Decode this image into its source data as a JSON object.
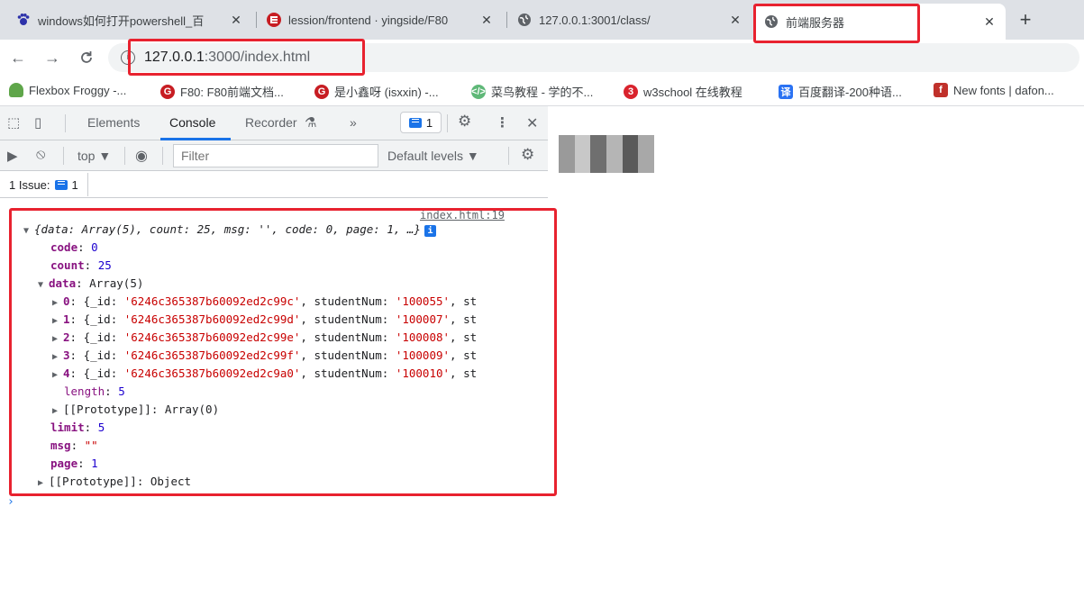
{
  "browser": {
    "tabs": [
      {
        "title": "windows如何打开powershell_百",
        "icon": "paw-icon"
      },
      {
        "title": "lession/frontend · yingside/F80",
        "icon": "gitee-icon"
      },
      {
        "title": "127.0.0.1:3001/class/",
        "icon": "globe-icon"
      },
      {
        "title": "前端服务器",
        "icon": "globe-icon",
        "active": true
      }
    ],
    "new_tab": "+",
    "close_glyph": "✕",
    "url_host": "127.0.0.1",
    "url_rest": ":3000/index.html"
  },
  "bookmarks": [
    {
      "label": "Flexbox Froggy -...",
      "icon": "frog-icon",
      "color": "#5fa64a"
    },
    {
      "label": "F80: F80前端文档...",
      "icon": "gitee-icon",
      "color": "#c71d23"
    },
    {
      "label": "是小鑫呀 (isxxin) -...",
      "icon": "gitee-icon",
      "color": "#c71d23"
    },
    {
      "label": "菜鸟教程 - 学的不...",
      "icon": "runoob-icon",
      "color": "#5fb878"
    },
    {
      "label": "w3school 在线教程",
      "icon": "w3school-icon",
      "color": "#d9232d"
    },
    {
      "label": "百度翻译-200种语...",
      "icon": "baidu-translate-icon",
      "color": "#2a72f3"
    },
    {
      "label": "New fonts | dafon...",
      "icon": "dafont-icon",
      "color": "#c0312b"
    }
  ],
  "devtools": {
    "tabs": [
      "Elements",
      "Console",
      "Recorder"
    ],
    "more": "»",
    "issues_count": "1",
    "context": "top ▼",
    "filter_placeholder": "Filter",
    "levels": "Default levels ▼",
    "issue_label": "1 Issue:",
    "issue_count": "1"
  },
  "console": {
    "source": "index.html:19",
    "summary": "{data: Array(5), count: 25, msg: '', code: 0, page: 1, …}",
    "code_key": "code",
    "code_val": "0",
    "count_key": "count",
    "count_val": "25",
    "data_key": "data",
    "data_val": "Array(5)",
    "rows": [
      {
        "idx": "0",
        "id": "'6246c365387b60092ed2c99c'",
        "num": "'100055'"
      },
      {
        "idx": "1",
        "id": "'6246c365387b60092ed2c99d'",
        "num": "'100007'"
      },
      {
        "idx": "2",
        "id": "'6246c365387b60092ed2c99e'",
        "num": "'100008'"
      },
      {
        "idx": "3",
        "id": "'6246c365387b60092ed2c99f'",
        "num": "'100009'"
      },
      {
        "idx": "4",
        "id": "'6246c365387b60092ed2c9a0'",
        "num": "'100010'"
      }
    ],
    "row_id_key": "_id",
    "row_num_key": "studentNum",
    "row_tail": "st",
    "length_key": "length",
    "length_val": "5",
    "proto_array": "[[Prototype]]: Array(0)",
    "limit_key": "limit",
    "limit_val": "5",
    "msg_key": "msg",
    "msg_val": "\"\"",
    "page_key": "page",
    "page_val": "1",
    "proto_object": "[[Prototype]]: Object",
    "prompt": "›"
  }
}
